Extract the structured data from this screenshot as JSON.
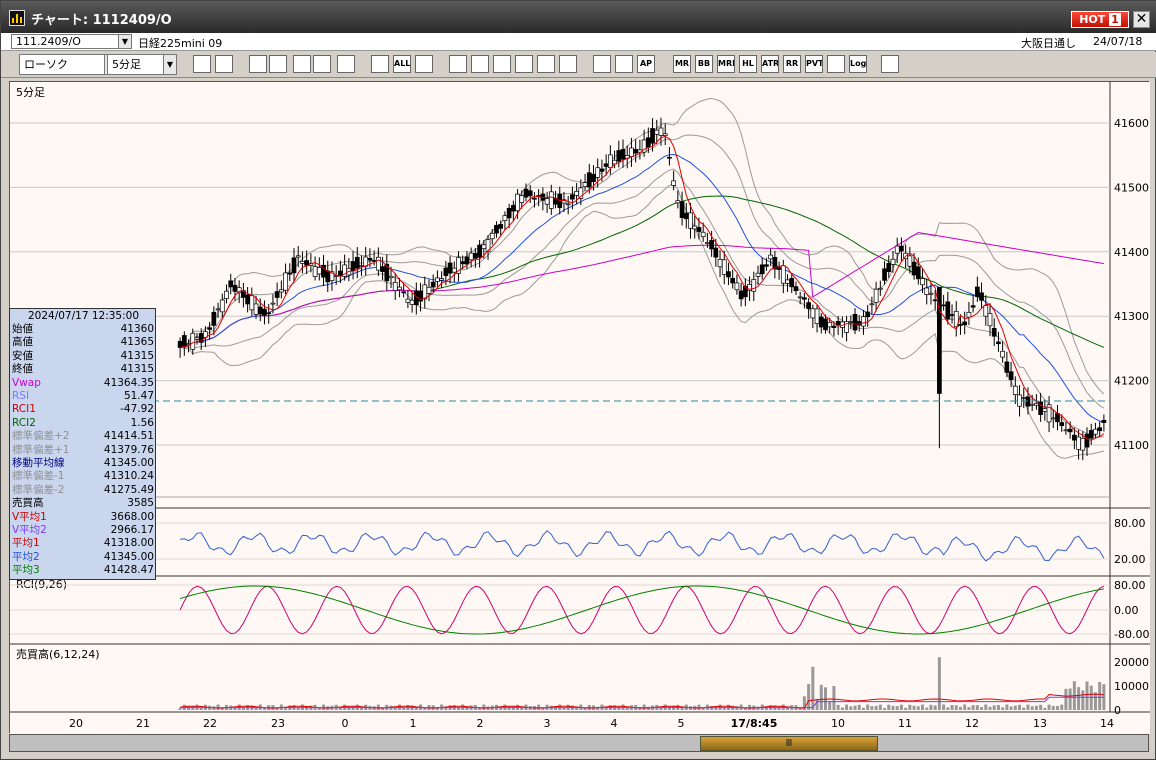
{
  "window": {
    "title": "チャート: 1112409/O",
    "hot_label": "HOT",
    "hot_number": "1",
    "close_glyph": "✕"
  },
  "symbol_bar": {
    "code": "111.2409/O",
    "name": "日経225mini 09",
    "market": "大阪日通し",
    "date": "24/07/18"
  },
  "toolbar": {
    "chart_type": "ローソク",
    "period": "5分足",
    "buttons": [
      "zoom",
      "grid",
      "down",
      "ptn",
      "mark",
      "vol",
      "cndl",
      "xcndl",
      "ALL",
      "draw",
      "line",
      "cursor",
      "trend",
      "notes",
      "bin",
      "gear",
      "tool",
      "palette",
      "AP",
      "MR",
      "BB",
      "MRE",
      "HL",
      "ATR",
      "RR",
      "PVT",
      "box",
      "Log",
      "exit"
    ],
    "button_labels": {
      "AP": "AP",
      "MR": "MR",
      "BB": "BB",
      "MRE": "MRE",
      "HL": "HL",
      "ATR": "ATR",
      "RR": "RR",
      "PVT": "PVT",
      "ALL": "ALL",
      "Log": "Log"
    }
  },
  "chart": {
    "period_label": "5分足",
    "price_ticks": [
      "41600",
      "41500",
      "41400",
      "41300",
      "41200",
      "41100"
    ],
    "rsi_ticks": [
      "80.00",
      "20.00"
    ],
    "rci_title": "RCI(9,26)",
    "rci_ticks": [
      "80.00",
      "0.00",
      "-80.00"
    ],
    "vol_title": "売買高(6,12,24)",
    "vol_ticks": [
      "20000",
      "10000",
      "0"
    ],
    "x_ticks": [
      "20",
      "21",
      "22",
      "23",
      "0",
      "1",
      "2",
      "3",
      "4",
      "5",
      "17/8:45",
      "10",
      "11",
      "12",
      "13",
      "14"
    ],
    "colors": {
      "candle_up": "#ffffff",
      "candle_down": "#000000",
      "ma_red": "#e00000",
      "ma_blue": "#2050e0",
      "ma_green": "#006600",
      "vwap": "#cc00cc",
      "band": "#9a9a9a",
      "rsi": "#3060d0",
      "rci1": "#d00070",
      "rci2": "#008000",
      "volume": "#999999"
    }
  },
  "infobox": {
    "datetime": "2024/07/17 12:35:00",
    "rows": [
      {
        "label": "始値",
        "value": "41360",
        "color": "#000000"
      },
      {
        "label": "高値",
        "value": "41365",
        "color": "#000000"
      },
      {
        "label": "安値",
        "value": "41315",
        "color": "#000000"
      },
      {
        "label": "終値",
        "value": "41315",
        "color": "#000000"
      },
      {
        "label": "Vwap",
        "value": "41364.35",
        "color": "#cc00cc"
      },
      {
        "label": "RSI",
        "value": "51.47",
        "color": "#7a7aff"
      },
      {
        "label": "RCI1",
        "value": "-47.92",
        "color": "#cc0000"
      },
      {
        "label": "RCI2",
        "value": "1.56",
        "color": "#006600"
      },
      {
        "label": "標準偏差+2",
        "value": "41414.51",
        "color": "#909090"
      },
      {
        "label": "標準偏差+1",
        "value": "41379.76",
        "color": "#909090"
      },
      {
        "label": "移動平均線",
        "value": "41345.00",
        "color": "#000080"
      },
      {
        "label": "標準偏差-1",
        "value": "41310.24",
        "color": "#909090"
      },
      {
        "label": "標準偏差-2",
        "value": "41275.49",
        "color": "#909090"
      },
      {
        "label": "売買高",
        "value": "3585",
        "color": "#000000"
      },
      {
        "label": "V平均1",
        "value": "3668.00",
        "color": "#cc0000"
      },
      {
        "label": "V平均2",
        "value": "2966.17",
        "color": "#7a3aff"
      },
      {
        "label": "平均1",
        "value": "41318.00",
        "color": "#cc0000"
      },
      {
        "label": "平均2",
        "value": "41345.00",
        "color": "#2050e0"
      },
      {
        "label": "平均3",
        "value": "41428.47",
        "color": "#008000"
      }
    ]
  },
  "scrollbar": {
    "thumb_glyph": "Ⅲ"
  }
}
